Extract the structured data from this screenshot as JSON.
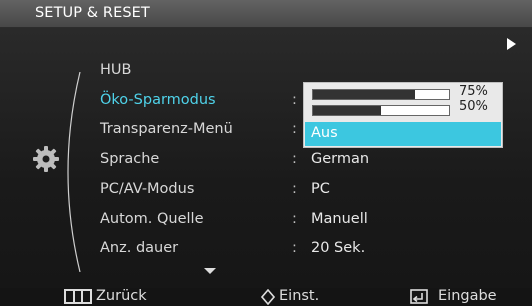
{
  "header": {
    "title": "SETUP & RESET"
  },
  "menu": {
    "items": [
      {
        "label": "HUB",
        "value": ""
      },
      {
        "label": "Öko-Sparmodus",
        "value": ""
      },
      {
        "label": "Transparenz-Menü",
        "value": ""
      },
      {
        "label": "Sprache",
        "value": "German"
      },
      {
        "label": "PC/AV-Modus",
        "value": "PC"
      },
      {
        "label": "Autom. Quelle",
        "value": "Manuell"
      },
      {
        "label": "Anz. dauer",
        "value": "20 Sek."
      }
    ],
    "active_index": 1
  },
  "popup": {
    "options": [
      {
        "label": "75%",
        "level": 0.75
      },
      {
        "label": "50%",
        "level": 0.5
      }
    ],
    "selected": "Aus"
  },
  "footer": {
    "back_label": "Zurück",
    "adjust_label": "Einst.",
    "enter_label": "Eingabe"
  },
  "colors": {
    "accent": "#3cc7e0",
    "active_text": "#4fd3ea"
  },
  "icons": [
    "gear-icon",
    "right-arrow-icon",
    "down-arrow-icon",
    "return-icon",
    "updown-icon",
    "enter-icon"
  ]
}
